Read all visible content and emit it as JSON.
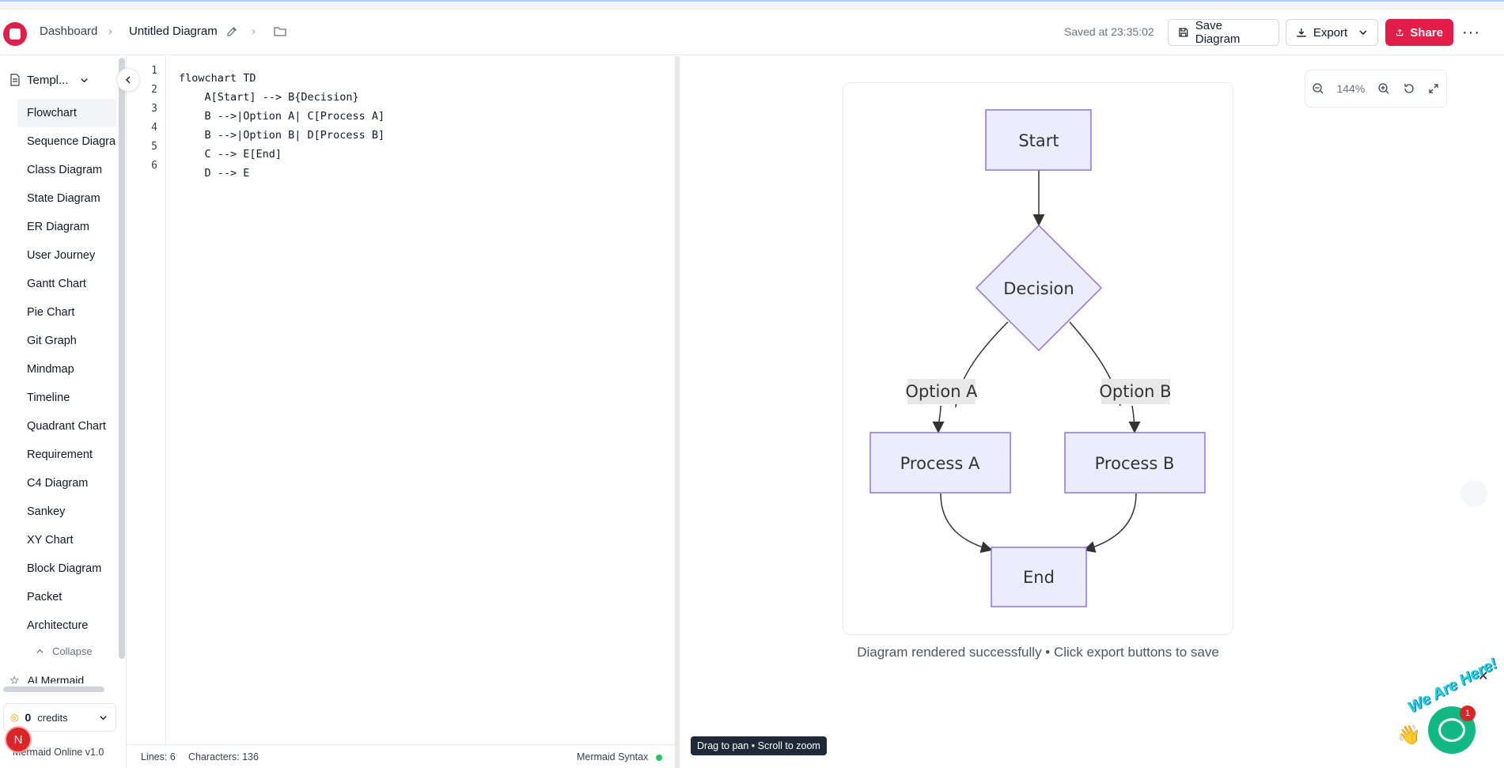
{
  "header": {
    "breadcrumb_dashboard": "Dashboard",
    "breadcrumb_title": "Untitled Diagram",
    "saved_text": "Saved at 23:35:02",
    "save_label": "Save Diagram",
    "export_label": "Export",
    "share_label": "Share"
  },
  "sidebar": {
    "templates_label": "Templ...",
    "items": [
      {
        "label": "Flowchart"
      },
      {
        "label": "Sequence Diagra"
      },
      {
        "label": "Class Diagram"
      },
      {
        "label": "State Diagram"
      },
      {
        "label": "ER Diagram"
      },
      {
        "label": "User Journey"
      },
      {
        "label": "Gantt Chart"
      },
      {
        "label": "Pie Chart"
      },
      {
        "label": "Git Graph"
      },
      {
        "label": "Mindmap"
      },
      {
        "label": "Timeline"
      },
      {
        "label": "Quadrant Chart"
      },
      {
        "label": "Requirement"
      },
      {
        "label": "C4 Diagram"
      },
      {
        "label": "Sankey"
      },
      {
        "label": "XY Chart"
      },
      {
        "label": "Block Diagram"
      },
      {
        "label": "Packet"
      },
      {
        "label": "Architecture"
      }
    ],
    "collapse_label": "Collapse",
    "ai_label": "AI Mermaid",
    "credits_value": "0",
    "credits_label": "credits",
    "avatar_initial": "N",
    "version": "Mermaid Online v1.0"
  },
  "editor": {
    "line_numbers": [
      "1",
      "2",
      "3",
      "4",
      "5",
      "6"
    ],
    "lines": [
      "flowchart TD",
      "    A[Start] --> B{Decision}",
      "    B -->|Option A| C[Process A]",
      "    B -->|Option B| D[Process B]",
      "    C --> E[End]",
      "    D --> E"
    ],
    "status_lines": "Lines: 6",
    "status_chars": "Characters: 136",
    "status_syntax": "Mermaid Syntax"
  },
  "preview": {
    "zoom": "144%",
    "caption": "Diagram rendered successfully • Click export buttons to save",
    "tooltip": "Drag to pan • Scroll to zoom",
    "nodes": {
      "start": "Start",
      "decision": "Decision",
      "process_a": "Process A",
      "process_b": "Process B",
      "end": "End"
    },
    "edge_labels": {
      "option_a": "Option A",
      "option_b": "Option B"
    }
  },
  "chat": {
    "badge_text": "We Are Here!",
    "count": "1",
    "close": "✕"
  },
  "colors": {
    "accent": "#e11d48",
    "node_fill": "#ECECFF",
    "node_stroke": "#9370DB"
  }
}
